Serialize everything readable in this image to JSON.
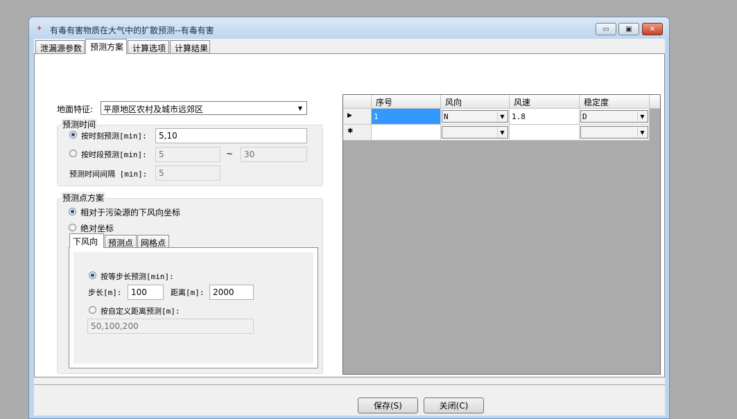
{
  "window": {
    "title": "有毒有害物质在大气中的扩散预测--有毒有害",
    "app_icon_text": "✈",
    "minimize_glyph": "▭",
    "maximize_glyph": "▣",
    "close_glyph": "✕"
  },
  "tabs": [
    {
      "label": "泄漏源参数"
    },
    {
      "label": "预测方案"
    },
    {
      "label": "计算选项"
    },
    {
      "label": "计算结果"
    }
  ],
  "terrain": {
    "label": "地面特征:",
    "value": "平原地区农村及城市远郊区"
  },
  "predict_time": {
    "group_title": "预测时间",
    "by_moment_label": "按时刻预测[min]:",
    "by_moment_value": "5,10",
    "by_period_label": "按时段预测[min]:",
    "period_start": "5",
    "tilde": "~",
    "period_end": "30",
    "interval_label": "预测时间间隔 [min]:",
    "interval_value": "5"
  },
  "predict_points": {
    "group_title": "预测点方案",
    "relative_label": "相对于污染源的下风向坐标",
    "absolute_label": "绝对坐标",
    "inner_tabs": [
      {
        "label": "下风向"
      },
      {
        "label": "预测点"
      },
      {
        "label": "网格点"
      }
    ],
    "equal_step_label": "按等步长预测[min]:",
    "step_label": "步长[m]:",
    "step_value": "100",
    "distance_label": "距离[m]:",
    "distance_value": "2000",
    "custom_label": "按自定义距离预测[m]:",
    "custom_value": "50,100,200"
  },
  "grid": {
    "columns": [
      "序号",
      "风向",
      "风速",
      "稳定度"
    ],
    "row_indicator": "▶",
    "new_row_indicator": "✱",
    "rows": [
      {
        "no": "1",
        "direction": "N",
        "speed": "1.8",
        "stability": "D"
      }
    ]
  },
  "buttons": {
    "save": "保存(S)",
    "close": "关闭(C)"
  },
  "colors": {
    "background": "#ababab",
    "selection": "#3399ff",
    "close_button": "#c4412a"
  }
}
